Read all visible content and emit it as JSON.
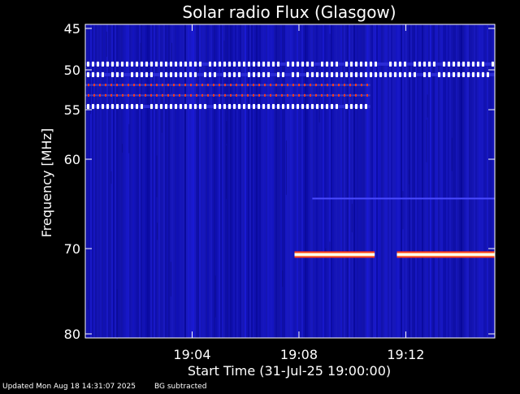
{
  "chart_data": {
    "type": "heatmap",
    "title": "Solar radio Flux (Glasgow)",
    "xlabel": "Start Time (31-Jul-25 19:00:00)",
    "ylabel": "Frequency [MHz]",
    "x_unit": "time",
    "xlim": [
      "19:00:00",
      "19:15:20"
    ],
    "ylim": [
      45,
      80
    ],
    "y_axis_direction": "increasing-downward",
    "x_ticks": [
      "19:04",
      "19:08",
      "19:12"
    ],
    "y_ticks": [
      45,
      50,
      55,
      60,
      70,
      80
    ],
    "colors": {
      "background_field": "#1a1ab4",
      "high_intensity": "#ffffff",
      "mid_intensity": "#ff3a1a",
      "band_core": "#fff4b0"
    },
    "features": [
      {
        "kind": "interference",
        "freq_mhz": 49.3,
        "start": "19:00:00",
        "end": "19:15:20",
        "pattern": "dashed"
      },
      {
        "kind": "interference",
        "freq_mhz": 50.6,
        "start": "19:00:00",
        "end": "19:15:20",
        "pattern": "dashed"
      },
      {
        "kind": "interference",
        "freq_mhz": 51.9,
        "start": "19:00:00",
        "end": "19:10:40",
        "pattern": "dotted-red"
      },
      {
        "kind": "interference",
        "freq_mhz": 53.2,
        "start": "19:00:00",
        "end": "19:10:40",
        "pattern": "dotted-red"
      },
      {
        "kind": "interference",
        "freq_mhz": 54.6,
        "start": "19:00:00",
        "end": "19:10:40",
        "pattern": "dashed"
      },
      {
        "kind": "carrier",
        "freq_mhz": 64.4,
        "start": "19:08:30",
        "end": "19:15:20",
        "pattern": "solid-faint"
      },
      {
        "kind": "carrier",
        "freq_mhz": 70.7,
        "start": "19:07:50",
        "end": "19:10:50",
        "pattern": "solid-bright"
      },
      {
        "kind": "carrier",
        "freq_mhz": 70.7,
        "start": "19:11:40",
        "end": "19:15:20",
        "pattern": "solid-bright"
      }
    ]
  },
  "footer": {
    "updated": "Updated Mon Aug 18 14:31:07 2025",
    "bg": "BG subtracted"
  }
}
